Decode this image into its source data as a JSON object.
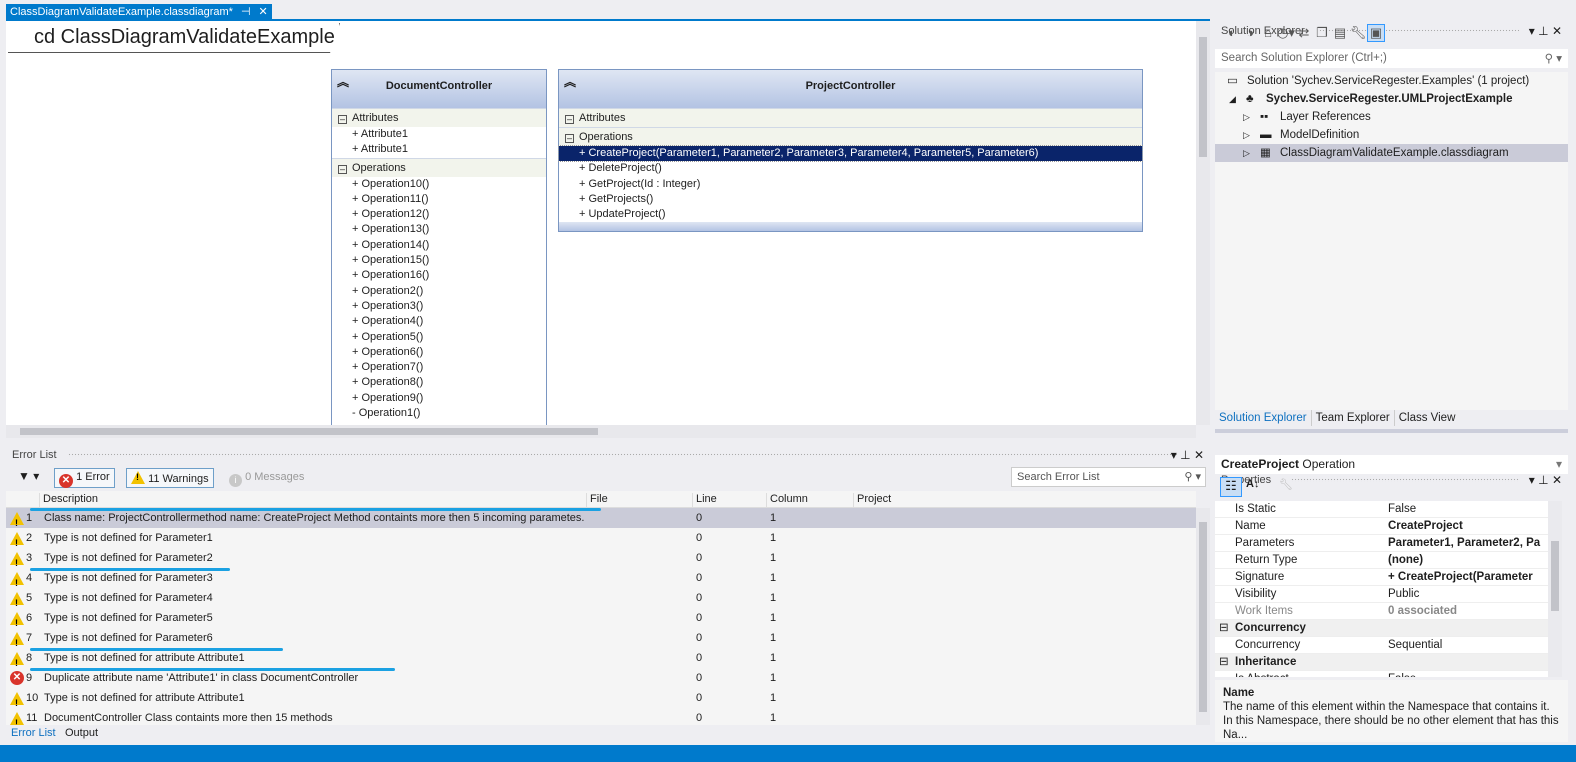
{
  "editor": {
    "tab_label": "ClassDiagramValidateExample.classdiagram*",
    "diagram_title": "cd ClassDiagramValidateExample"
  },
  "classes": [
    {
      "name": "DocumentController",
      "sections": [
        {
          "label": "Attributes",
          "items": [
            "+ Attribute1",
            "+ Attribute1"
          ]
        },
        {
          "label": "Operations",
          "items": [
            "+ Operation10()",
            "+ Operation11()",
            "+ Operation12()",
            "+ Operation13()",
            "+ Operation14()",
            "+ Operation15()",
            "+ Operation16()",
            "+ Operation2()",
            "+ Operation3()",
            "+ Operation4()",
            "+ Operation5()",
            "+ Operation6()",
            "+ Operation7()",
            "+ Operation8()",
            "+ Operation9()",
            "- Operation1()"
          ]
        }
      ]
    },
    {
      "name": "ProjectController",
      "selected_item": "+ CreateProject(Parameter1, Parameter2, Parameter3, Parameter4, Parameter5, Parameter6)",
      "sections": [
        {
          "label": "Attributes",
          "items": []
        },
        {
          "label": "Operations",
          "items": [
            "+ CreateProject(Parameter1, Parameter2, Parameter3, Parameter4, Parameter5, Parameter6)",
            "+ DeleteProject()",
            "+ GetProject(Id : Integer)",
            "+ GetProjects()",
            "+ UpdateProject()"
          ]
        }
      ]
    }
  ],
  "error_list": {
    "title": "Error List",
    "errors_btn": "1 Error",
    "warnings_btn": "11 Warnings",
    "messages_btn": "0 Messages",
    "search_placeholder": "Search Error List",
    "columns": [
      "Description",
      "File",
      "Line",
      "Column",
      "Project"
    ],
    "rows": [
      {
        "type": "warning",
        "n": "1",
        "desc": "Class name: ProjectControllermethod name: CreateProject Method containts more then 5 incoming parametes.",
        "line": "0",
        "col": "1",
        "selected": true,
        "underlined": true
      },
      {
        "type": "warning",
        "n": "2",
        "desc": "Type is not defined for Parameter1",
        "line": "0",
        "col": "1"
      },
      {
        "type": "warning",
        "n": "3",
        "desc": "Type is not defined for Parameter2",
        "line": "0",
        "col": "1"
      },
      {
        "type": "warning",
        "n": "4",
        "desc": "Type is not defined for Parameter3",
        "line": "0",
        "col": "1",
        "underlined": true
      },
      {
        "type": "warning",
        "n": "5",
        "desc": "Type is not defined for Parameter4",
        "line": "0",
        "col": "1"
      },
      {
        "type": "warning",
        "n": "6",
        "desc": "Type is not defined for Parameter5",
        "line": "0",
        "col": "1"
      },
      {
        "type": "warning",
        "n": "7",
        "desc": "Type is not defined for Parameter6",
        "line": "0",
        "col": "1"
      },
      {
        "type": "warning",
        "n": "8",
        "desc": "Type is not defined for attribute Attribute1",
        "line": "0",
        "col": "1",
        "underlined": true
      },
      {
        "type": "error",
        "n": "9",
        "desc": "Duplicate attribute name 'Attribute1' in class DocumentController",
        "line": "0",
        "col": "1",
        "underlined": true
      },
      {
        "type": "warning",
        "n": "10",
        "desc": "Type is not defined for attribute Attribute1",
        "line": "0",
        "col": "1"
      },
      {
        "type": "warning",
        "n": "11",
        "desc": "DocumentController Class containts more then 15 methods",
        "line": "0",
        "col": "1"
      }
    ],
    "bottom_tabs": [
      "Error List",
      "Output"
    ]
  },
  "solution_explorer": {
    "title": "Solution Explorer",
    "search_placeholder": "Search Solution Explorer (Ctrl+;)",
    "tree": [
      {
        "label": "Solution 'Sychev.ServiceRegester.Examples' (1 project)",
        "level": 0,
        "icon": "solution-icon"
      },
      {
        "label": "Sychev.ServiceRegester.UMLProjectExample",
        "level": 1,
        "icon": "modeling-project-icon",
        "bold": true,
        "expanded": true
      },
      {
        "label": "Layer References",
        "level": 2,
        "icon": "layer-icon"
      },
      {
        "label": "ModelDefinition",
        "level": 2,
        "icon": "folder-icon"
      },
      {
        "label": "ClassDiagramValidateExample.classdiagram",
        "level": 2,
        "icon": "class-diagram-icon",
        "selected": true
      }
    ],
    "tabs": [
      "Solution Explorer",
      "Team Explorer",
      "Class View"
    ]
  },
  "properties": {
    "title": "Properties",
    "object_name": "CreateProject",
    "object_type": "Operation",
    "rows": [
      {
        "name": "Is Static",
        "value": "False"
      },
      {
        "name": "Name",
        "value": "CreateProject",
        "bold": true
      },
      {
        "name": "Parameters",
        "value": "Parameter1, Parameter2, Pa",
        "bold": true
      },
      {
        "name": "Return Type",
        "value": "(none)",
        "bold": true
      },
      {
        "name": "Signature",
        "value": "+ CreateProject(Parameter",
        "bold": true
      },
      {
        "name": "Visibility",
        "value": "Public"
      },
      {
        "name": "Work Items",
        "value": "0 associated",
        "bold": true,
        "gray": true
      },
      {
        "category": "Concurrency"
      },
      {
        "name": "Concurrency",
        "value": "Sequential"
      },
      {
        "category": "Inheritance"
      },
      {
        "name": "Is Abstract",
        "value": "False"
      }
    ],
    "desc_title": "Name",
    "desc_text": "The name of this element within the Namespace that contains it. In this Namespace, there should be no other element that has this Na..."
  },
  "colors": {
    "accent": "#007acc",
    "selection": "#0a246a",
    "highlight": "#1ba1e2"
  }
}
